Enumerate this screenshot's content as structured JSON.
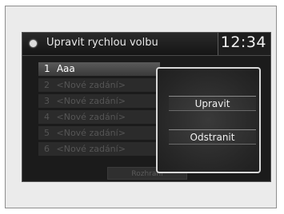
{
  "header": {
    "title": "Upravit rychlou volbu",
    "clock": "12:34",
    "icon": "settings-dot-icon"
  },
  "list": {
    "items": [
      {
        "num": "1",
        "label": "Aaa",
        "active": true
      },
      {
        "num": "2",
        "label": "<Nové zadání>",
        "active": false
      },
      {
        "num": "3",
        "label": "<Nové zadání>",
        "active": false
      },
      {
        "num": "4",
        "label": "<Nové zadání>",
        "active": false
      },
      {
        "num": "5",
        "label": "<Nové zadání>",
        "active": false
      },
      {
        "num": "6",
        "label": "<Nové zadání>",
        "active": false
      }
    ],
    "bottom_button": "Rozhraní"
  },
  "popup": {
    "edit_label": "Upravit",
    "delete_label": "Odstranit"
  }
}
